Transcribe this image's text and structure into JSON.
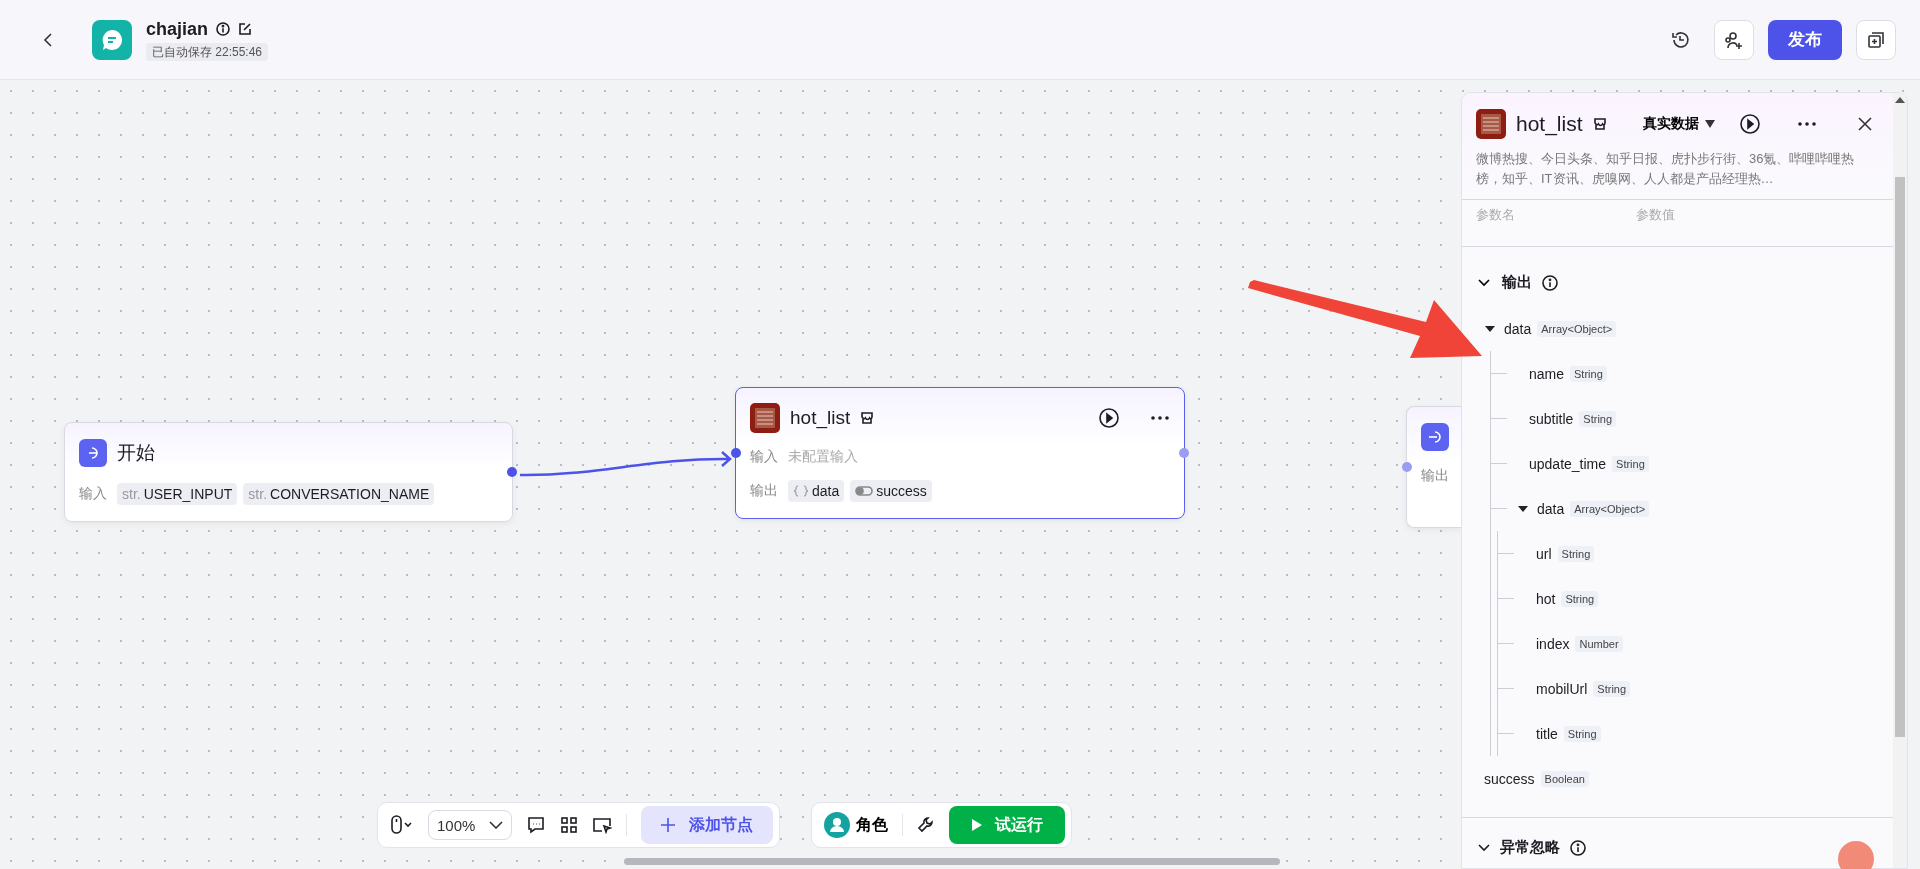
{
  "header": {
    "app_name": "chajian",
    "autosave": "已自动保存 22:55:46",
    "publish_button": "发布"
  },
  "canvas": {
    "nodes": [
      {
        "kind": "start",
        "title": "开始",
        "selected": false,
        "rows": [
          {
            "label": "输入",
            "tags": [
              {
                "kind": "string",
                "prefix": "str.",
                "name": "USER_INPUT"
              },
              {
                "kind": "string",
                "prefix": "str.",
                "name": "CONVERSATION_NAME"
              }
            ]
          }
        ]
      },
      {
        "kind": "plugin",
        "title": "hot_list",
        "selected": true,
        "rows": [
          {
            "label": "输入",
            "value": "未配置输入"
          },
          {
            "label": "输出",
            "tags": [
              {
                "kind": "object",
                "name": "data"
              },
              {
                "kind": "boolean",
                "name": "success"
              }
            ]
          }
        ]
      },
      {
        "kind": "end",
        "selected": false,
        "rows": [
          {
            "label": "输出"
          }
        ]
      }
    ]
  },
  "panel": {
    "title": "hot_list",
    "mode": "真实数据",
    "description": "微博热搜、今日头条、知乎日报、虎扑步行街、36氪、哔哩哔哩热榜，知乎、IT资讯、虎嗅网、人人都是产品经理热…",
    "param_headers": [
      "参数名",
      "参数值"
    ],
    "output_section": {
      "title": "输出",
      "expanded": true,
      "fields": [
        {
          "name": "data",
          "type": "Array<Object>",
          "expanded": true,
          "children": [
            {
              "name": "name",
              "type": "String"
            },
            {
              "name": "subtitle",
              "type": "String"
            },
            {
              "name": "update_time",
              "type": "String"
            },
            {
              "name": "data",
              "type": "Array<Object>",
              "expanded": true,
              "children": [
                {
                  "name": "url",
                  "type": "String"
                },
                {
                  "name": "hot",
                  "type": "String"
                },
                {
                  "name": "index",
                  "type": "Number"
                },
                {
                  "name": "mobilUrl",
                  "type": "String"
                },
                {
                  "name": "title",
                  "type": "String"
                }
              ]
            }
          ]
        },
        {
          "name": "success",
          "type": "Boolean"
        }
      ]
    },
    "next_section": {
      "title": "异常忽略"
    }
  },
  "toolbar": {
    "zoom": "100%",
    "add_node": "添加节点",
    "role": "角色",
    "run": "试运行"
  }
}
